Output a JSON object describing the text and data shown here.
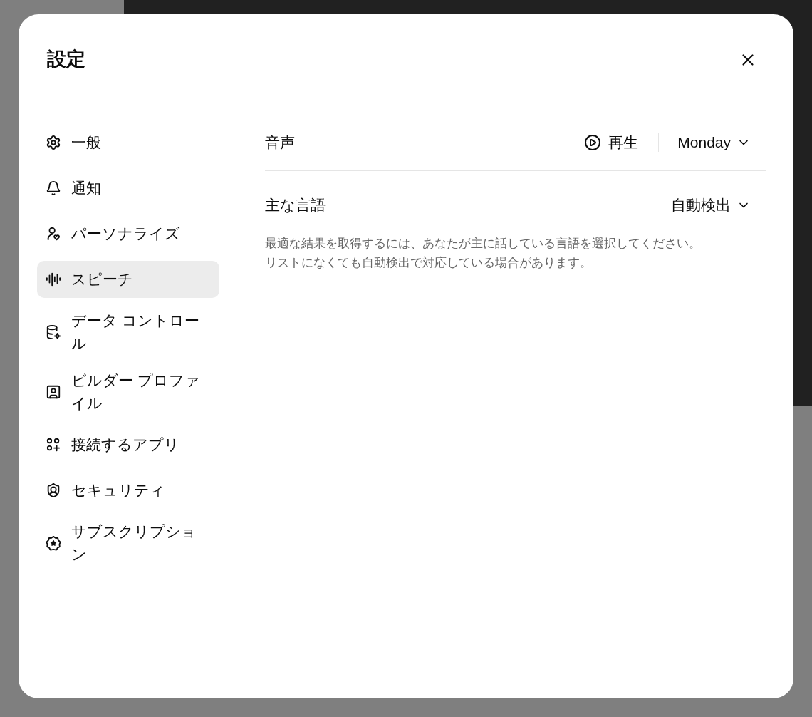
{
  "dialog": {
    "title": "設定"
  },
  "sidebar": {
    "items": [
      {
        "label": "一般",
        "selected": false
      },
      {
        "label": "通知",
        "selected": false
      },
      {
        "label": "パーソナライズ",
        "selected": false
      },
      {
        "label": "スピーチ",
        "selected": true
      },
      {
        "label": "データ コントロール",
        "selected": false
      },
      {
        "label": "ビルダー プロファイル",
        "selected": false
      },
      {
        "label": "接続するアプリ",
        "selected": false
      },
      {
        "label": "セキュリティ",
        "selected": false
      },
      {
        "label": "サブスクリプション",
        "selected": false
      }
    ]
  },
  "speech": {
    "voice": {
      "label": "音声",
      "play": "再生",
      "value": "Monday"
    },
    "language": {
      "label": "主な言語",
      "value": "自動検出",
      "description": "最適な結果を取得するには、あなたが主に話している言語を選択してください。リストになくても自動検出で対応している場合があります。"
    }
  }
}
